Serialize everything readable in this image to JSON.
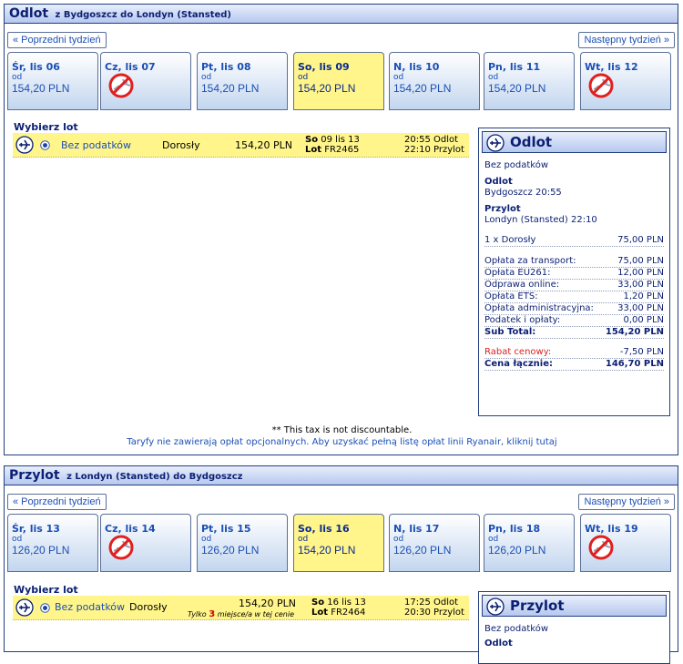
{
  "outbound": {
    "heading": "Odlot",
    "route": "z Bydgoszcz do Londyn (Stansted)",
    "prev_week": "« Poprzedni tydzień",
    "next_week": "Następny tydzień »",
    "days": [
      {
        "label": "Śr, lis 06",
        "od": "od",
        "price": "154,20 PLN"
      },
      {
        "label": "Cz, lis 07",
        "od": "",
        "price": "",
        "no_flight": true
      },
      {
        "label": "Pt, lis 08",
        "od": "od",
        "price": "154,20 PLN"
      },
      {
        "label": "So, lis 09",
        "od": "od",
        "price": "154,20 PLN",
        "selected": true
      },
      {
        "label": "N, lis 10",
        "od": "od",
        "price": "154,20 PLN"
      },
      {
        "label": "Pn, lis 11",
        "od": "od",
        "price": "154,20 PLN"
      },
      {
        "label": "Wt, lis 12",
        "od": "",
        "price": "",
        "no_flight": true
      }
    ],
    "choose_title": "Wybierz lot",
    "flight": {
      "tax_label": "Bez podatków",
      "passenger": "Dorosły",
      "price": "154,20 PLN",
      "day": "So",
      "date": "09 lis 13",
      "lot_label": "Lot",
      "flight_no": "FR2465",
      "dep": "20:55 Odlot",
      "arr": "22:10 Przylot"
    },
    "summary": {
      "title": "Odlot",
      "tax_label": "Bez podatków",
      "dep_title": "Odlot",
      "dep_value": "Bydgoszcz 20:55",
      "arr_title": "Przylot",
      "arr_value": "Londyn (Stansted) 22:10",
      "passenger_line": {
        "k": "1 x Dorosły",
        "v": "75,00 PLN"
      },
      "fees": [
        {
          "k": "Opłata za transport:",
          "v": "75,00 PLN"
        },
        {
          "k": "Opłata EU261:",
          "v": "12,00 PLN"
        },
        {
          "k": "Odprawa online:",
          "v": "33,00 PLN"
        },
        {
          "k": "Opłata ETS:",
          "v": "1,20 PLN"
        },
        {
          "k": "Opłata administracyjna:",
          "v": "33,00 PLN"
        },
        {
          "k": "Podatek i opłaty:",
          "v": "0,00 PLN"
        }
      ],
      "subtotal": {
        "k": "Sub Total:",
        "v": "154,20 PLN"
      },
      "discount": {
        "k": "Rabat cenowy:",
        "v": "-7,50 PLN"
      },
      "total": {
        "k": "Cena łącznie:",
        "v": "146,70 PLN"
      }
    },
    "note_tax": "** This tax is not discountable.",
    "note_fees": "Taryfy nie zawierają opłat opcjonalnych. Aby uzyskać pełną listę opłat linii Ryanair, kliknij tutaj"
  },
  "return": {
    "heading": "Przylot",
    "route": "z Londyn (Stansted) do Bydgoszcz",
    "prev_week": "« Poprzedni tydzień",
    "next_week": "Następny tydzień »",
    "days": [
      {
        "label": "Śr, lis 13",
        "od": "od",
        "price": "126,20 PLN"
      },
      {
        "label": "Cz, lis 14",
        "od": "",
        "price": "",
        "no_flight": true
      },
      {
        "label": "Pt, lis 15",
        "od": "od",
        "price": "126,20 PLN"
      },
      {
        "label": "So, lis 16",
        "od": "od",
        "price": "154,20 PLN",
        "selected": true
      },
      {
        "label": "N, lis 17",
        "od": "od",
        "price": "126,20 PLN"
      },
      {
        "label": "Pn, lis 18",
        "od": "od",
        "price": "126,20 PLN"
      },
      {
        "label": "Wt, lis 19",
        "od": "",
        "price": "",
        "no_flight": true
      }
    ],
    "choose_title": "Wybierz lot",
    "flight": {
      "tax_label": "Bez podatków",
      "passenger": "Dorosły",
      "price": "154,20 PLN",
      "seats_prefix": "Tylko",
      "seats_count": "3",
      "seats_suffix": "miejsce/a w tej cenie",
      "day": "So",
      "date": "16 lis 13",
      "lot_label": "Lot",
      "flight_no": "FR2464",
      "dep": "17:25 Odlot",
      "arr": "20:30 Przylot"
    },
    "summary": {
      "title": "Przylot",
      "tax_label": "Bez podatków",
      "dep_title": "Odlot"
    }
  }
}
